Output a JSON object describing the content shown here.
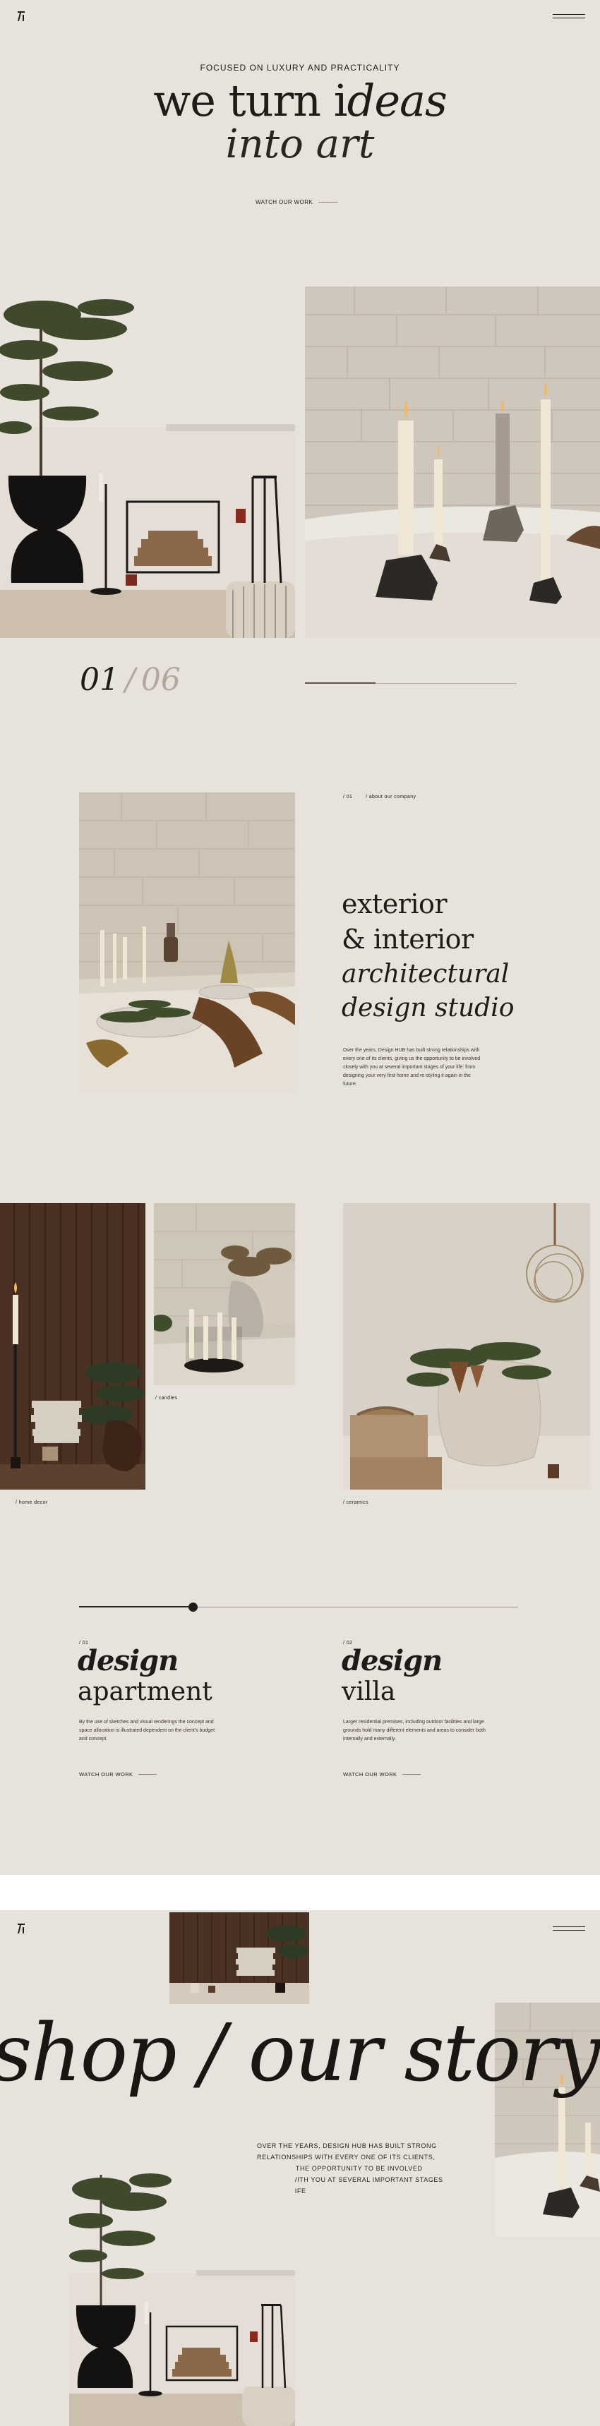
{
  "header": {
    "logo_icon": "logo-mark-icon",
    "menu_icon": "hamburger-menu-icon"
  },
  "hero": {
    "eyebrow": "FOCUSED ON LUXURY AND PRACTICALITY",
    "title_line1_a": "we turn i",
    "title_line1_b": "deas",
    "title_line2": "into art",
    "cta": "WATCH OUR WORK"
  },
  "counter": {
    "current": "01",
    "separator": "/",
    "total": "06"
  },
  "about": {
    "index": "/ 01",
    "label": "/ about our company",
    "title_line1": "exterior",
    "title_line2": "& interior",
    "title_line3": "architectural",
    "title_line4": "design studio",
    "text": "Over the years, Design HUB has built strong relationships with every one of its clients, giving us the opportunity to be involved closely with you at several important stages of your life: from designing your very first home and re-styling it again in the future."
  },
  "gallery": {
    "caption_home_decor": "/ home decor",
    "caption_candles": "/ candles",
    "caption_ceramics": "/ ceramics"
  },
  "services": [
    {
      "index": "/ 01",
      "title_a": "design",
      "title_b": "apartment",
      "text": "By the use of sketches and visual renderings the concept and space allocation is illustrated dependent on the client's budget and concept.",
      "cta": "WATCH OUR WORK"
    },
    {
      "index": "/ 02",
      "title_a": "design",
      "title_b": "villa",
      "text": "Larger residential premises, including outdoor facilities and large grounds hold many different elements and areas to consider both internally and externally.",
      "cta": "WATCH OUR WORK"
    }
  ],
  "shop": {
    "headline": "shop / our story",
    "text": "OVER THE YEARS, DESIGN HUB HAS BUILT STRONG RELATIONSHIPS WITH EVERY ONE OF ITS CLIENTS, GIVING US THE OPPORTUNITY TO BE INVOLVED CLOSELY WITH YOU AT SEVERAL IMPORTANT STAGES OF YOUR LIFE"
  },
  "colors": {
    "background": "#e8e2dc",
    "text": "#1f1b18",
    "divider": "#b8aea6"
  }
}
